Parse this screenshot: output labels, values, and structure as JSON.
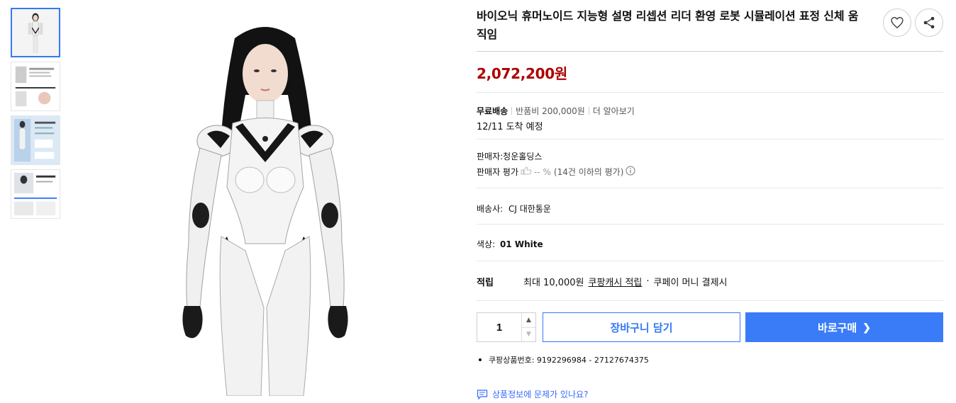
{
  "thumbnails": [
    {
      "name": "thumb-robot-front",
      "active": true
    },
    {
      "name": "thumb-robot-parts",
      "active": false
    },
    {
      "name": "thumb-robot-specs",
      "active": false
    },
    {
      "name": "thumb-robot-detail",
      "active": false
    }
  ],
  "product": {
    "title": "바이오닉 휴머노이드 지능형 설명 리셉션 리더 환영 로봇 시뮬레이션 표정 신체 움직임",
    "price": "2,072,200원"
  },
  "shipping": {
    "free_label": "무료배송",
    "return_fee": "반품비 200,000원",
    "learn_more": "더 알아보기",
    "arrival": "12/11 도착 예정"
  },
  "seller": {
    "name_line": "판매자:청운홀딩스",
    "rating_label": "판매자 평가",
    "rating_value": "-- %",
    "rating_note": "(14건 이하의 평가)"
  },
  "courier": {
    "label": "배송사:",
    "value": "CJ 대한통운"
  },
  "option": {
    "label": "색상:",
    "value": "01 White"
  },
  "reward": {
    "label": "적립",
    "amount": "최대 10,000원",
    "link": "쿠팡캐시 적립",
    "condition": "쿠페이 머니 결제시"
  },
  "purchase": {
    "quantity": "1",
    "cart_label": "장바구니 담기",
    "buy_label": "바로구매"
  },
  "product_number": "쿠팡상품번호: 9192296984 - 27127674375",
  "report_label": "상품정보에 문제가 있나요?",
  "colors": {
    "price": "#ae0000",
    "accent": "#3479f5"
  }
}
